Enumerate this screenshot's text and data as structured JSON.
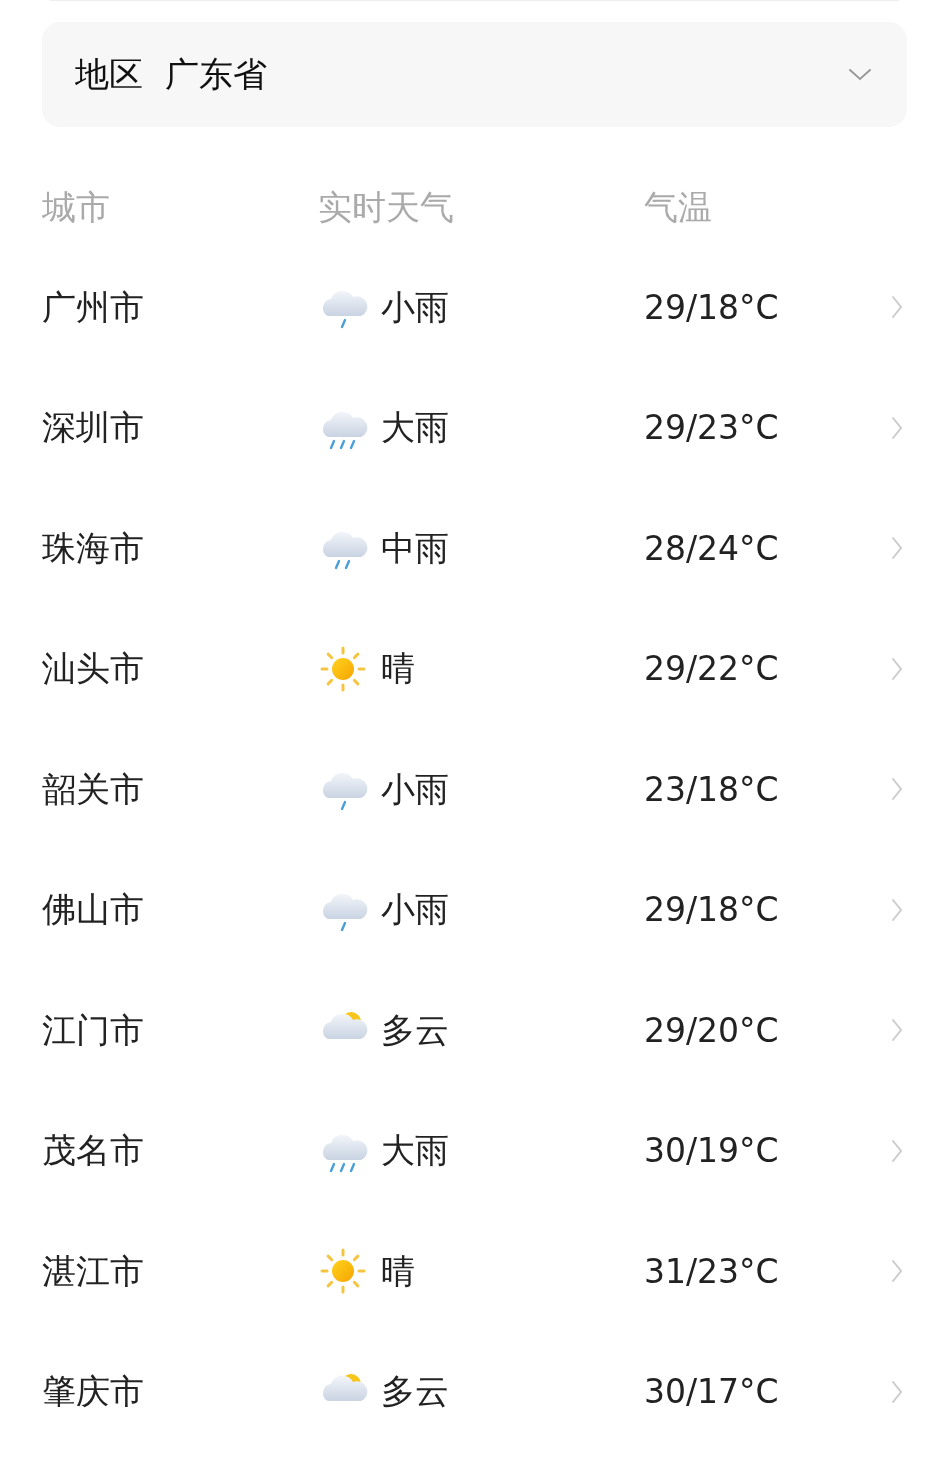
{
  "region": {
    "label": "地区",
    "value": "广东省"
  },
  "columns": [
    "城市",
    "实时天气",
    "气温"
  ],
  "rows": [
    {
      "city": "广州市",
      "kind": "light_rain",
      "weather": "小雨",
      "temp": "29/18°C"
    },
    {
      "city": "深圳市",
      "kind": "heavy_rain",
      "weather": "大雨",
      "temp": "29/23°C"
    },
    {
      "city": "珠海市",
      "kind": "moderate_rain",
      "weather": "中雨",
      "temp": "28/24°C"
    },
    {
      "city": "汕头市",
      "kind": "sunny",
      "weather": "晴",
      "temp": "29/22°C"
    },
    {
      "city": "韶关市",
      "kind": "light_rain",
      "weather": "小雨",
      "temp": "23/18°C"
    },
    {
      "city": "佛山市",
      "kind": "light_rain",
      "weather": "小雨",
      "temp": "29/18°C"
    },
    {
      "city": "江门市",
      "kind": "cloudy",
      "weather": "多云",
      "temp": "29/20°C"
    },
    {
      "city": "茂名市",
      "kind": "heavy_rain",
      "weather": "大雨",
      "temp": "30/19°C"
    },
    {
      "city": "湛江市",
      "kind": "sunny",
      "weather": "晴",
      "temp": "31/23°C"
    },
    {
      "city": "肇庆市",
      "kind": "cloudy",
      "weather": "多云",
      "temp": "30/17°C"
    }
  ]
}
